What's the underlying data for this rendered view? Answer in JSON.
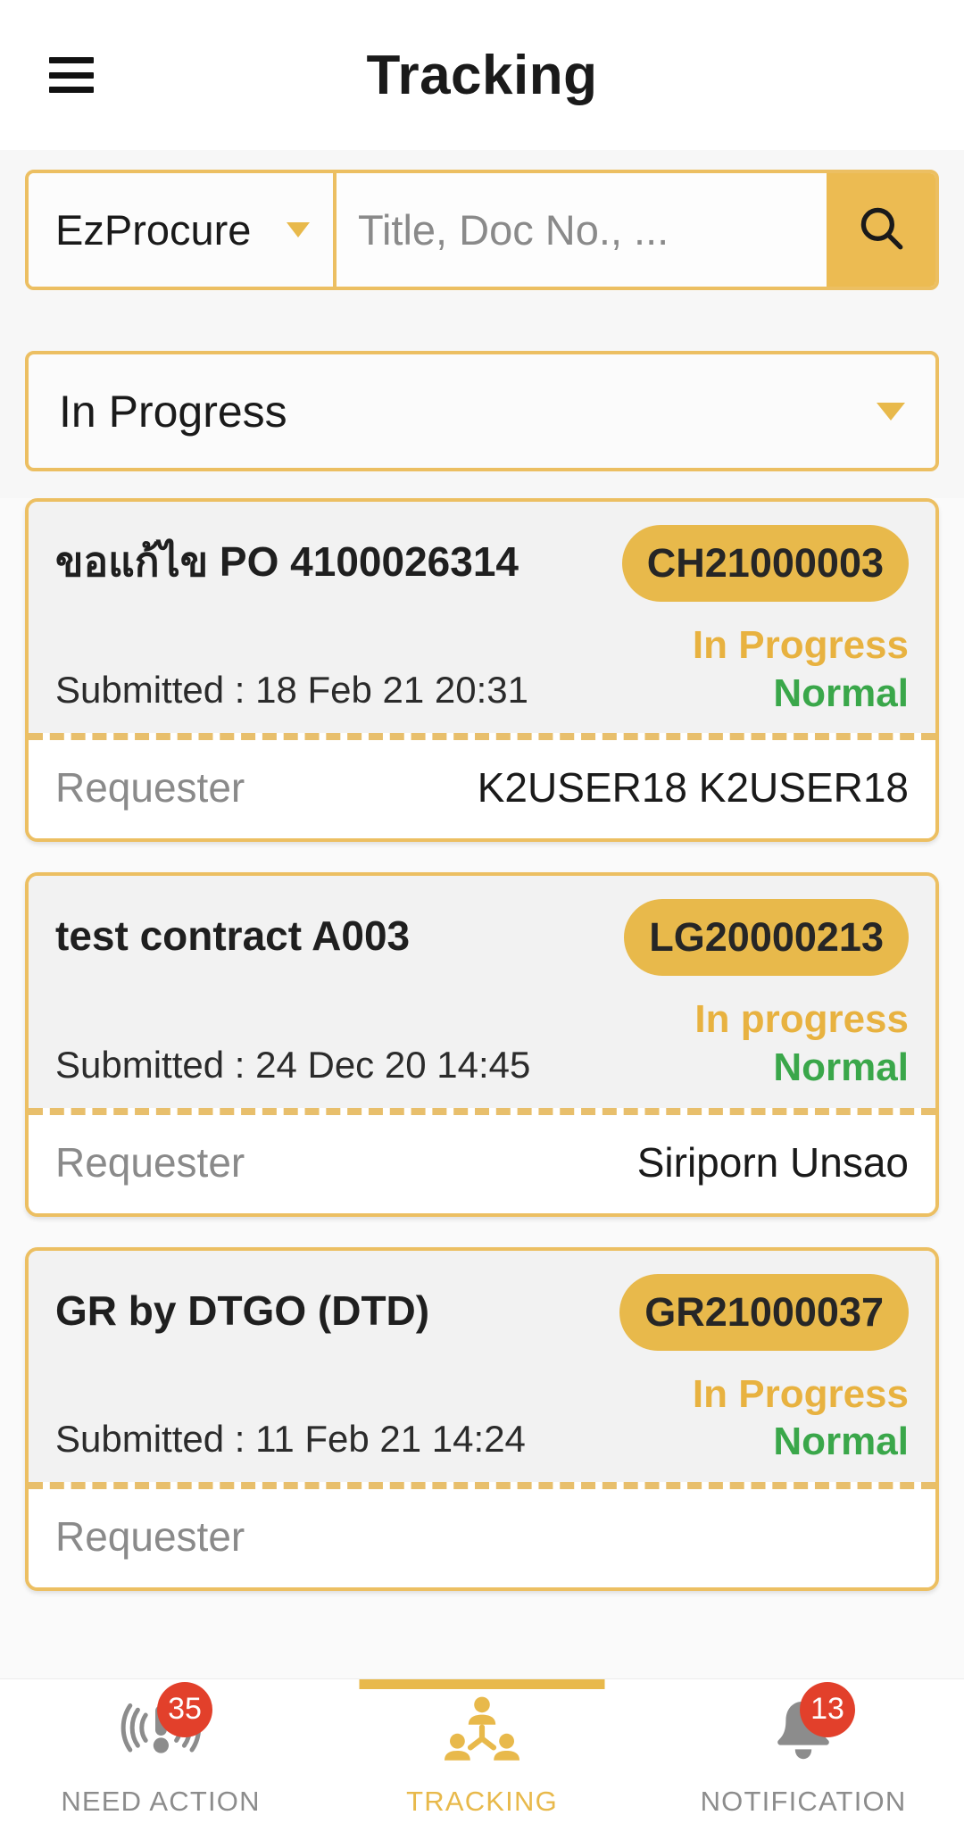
{
  "header": {
    "title": "Tracking",
    "menu_icon": "hamburger-menu-icon"
  },
  "search": {
    "source_value": "EzProcure",
    "placeholder": "Title, Doc No., ...",
    "input_value": "",
    "search_icon": "search-icon",
    "dropdown_icon": "chevron-down-icon"
  },
  "status_filter": {
    "value": "In Progress",
    "dropdown_icon": "chevron-down-icon"
  },
  "labels": {
    "submitted_prefix": "Submitted : ",
    "requester": "Requester"
  },
  "cards": [
    {
      "title": "ขอแก้ไข PO 4100026314",
      "doc_no": "CH21000003",
      "status": "In Progress",
      "priority": "Normal",
      "submitted": "Submitted : 18 Feb 21 20:31",
      "requester_label": "Requester",
      "requester": "K2USER18 K2USER18"
    },
    {
      "title": "test contract A003",
      "doc_no": "LG20000213",
      "status": "In progress",
      "priority": "Normal",
      "submitted": "Submitted : 24 Dec 20 14:45",
      "requester_label": "Requester",
      "requester": "Siriporn Unsao"
    },
    {
      "title": "GR by DTGO (DTD)",
      "doc_no": "GR21000037",
      "status": "In Progress",
      "priority": "Normal",
      "submitted": "Submitted : 11 Feb 21 14:24",
      "requester_label": "Requester",
      "requester": ""
    }
  ],
  "bottom_nav": {
    "items": [
      {
        "label": "NEED ACTION",
        "badge": "35",
        "icon": "alert-exclamation-icon",
        "active": false
      },
      {
        "label": "TRACKING",
        "badge": "",
        "icon": "org-chart-people-icon",
        "active": true
      },
      {
        "label": "NOTIFICATION",
        "badge": "13",
        "icon": "bell-icon",
        "active": false
      }
    ]
  },
  "colors": {
    "accent": "#e8b94b",
    "border": "#ecbf62",
    "status_progress": "#e8b240",
    "status_priority": "#3aa74a",
    "badge_red": "#e2402b",
    "card_top_bg": "#f2f2f2"
  }
}
